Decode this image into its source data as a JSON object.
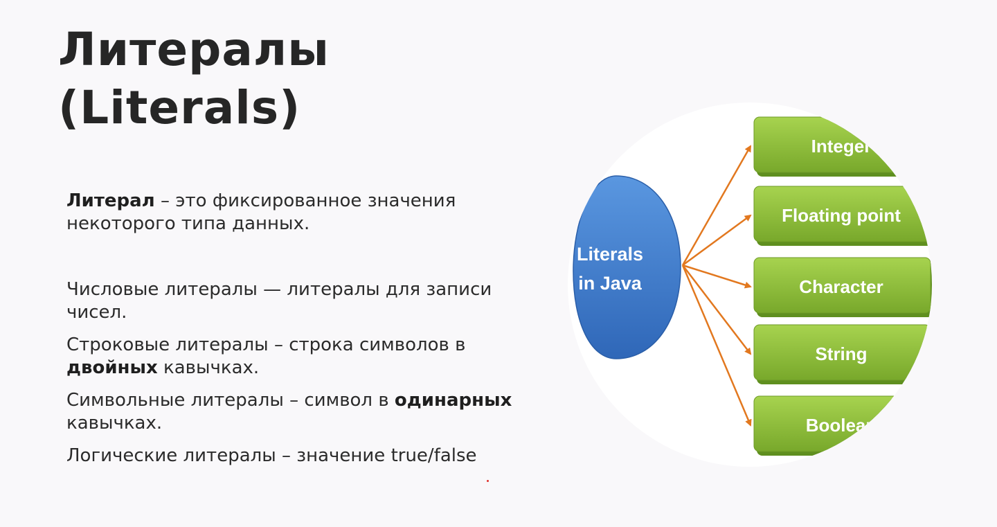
{
  "title": {
    "line1": "Литералы",
    "line2": "(Literals)"
  },
  "definition": {
    "term": "Литерал",
    "rest": " – это фиксированное значения некоторого типа данных."
  },
  "items": [
    {
      "before": "Числовые литералы — литералы для записи чисел.",
      "bold": "",
      "after": ""
    },
    {
      "before": "Строковые литералы – строка символов в ",
      "bold": "двойных",
      "after": " кавычках."
    },
    {
      "before": "Символьные литералы – символ в ",
      "bold": "одинарных",
      "after": " кавычках."
    },
    {
      "before": "Логические литералы – значение true/false",
      "bold": "",
      "after": ""
    }
  ],
  "diagram": {
    "center_line1": "Literals",
    "center_line2": "in Java",
    "nodes": [
      "Integer",
      "Floating point",
      "Character",
      "String",
      "Boolean"
    ],
    "colors": {
      "center": "#3f7fd1",
      "node_fill": "#8cbf3f",
      "node_dark": "#5f8f1f",
      "arrow": "#e2781f"
    }
  }
}
